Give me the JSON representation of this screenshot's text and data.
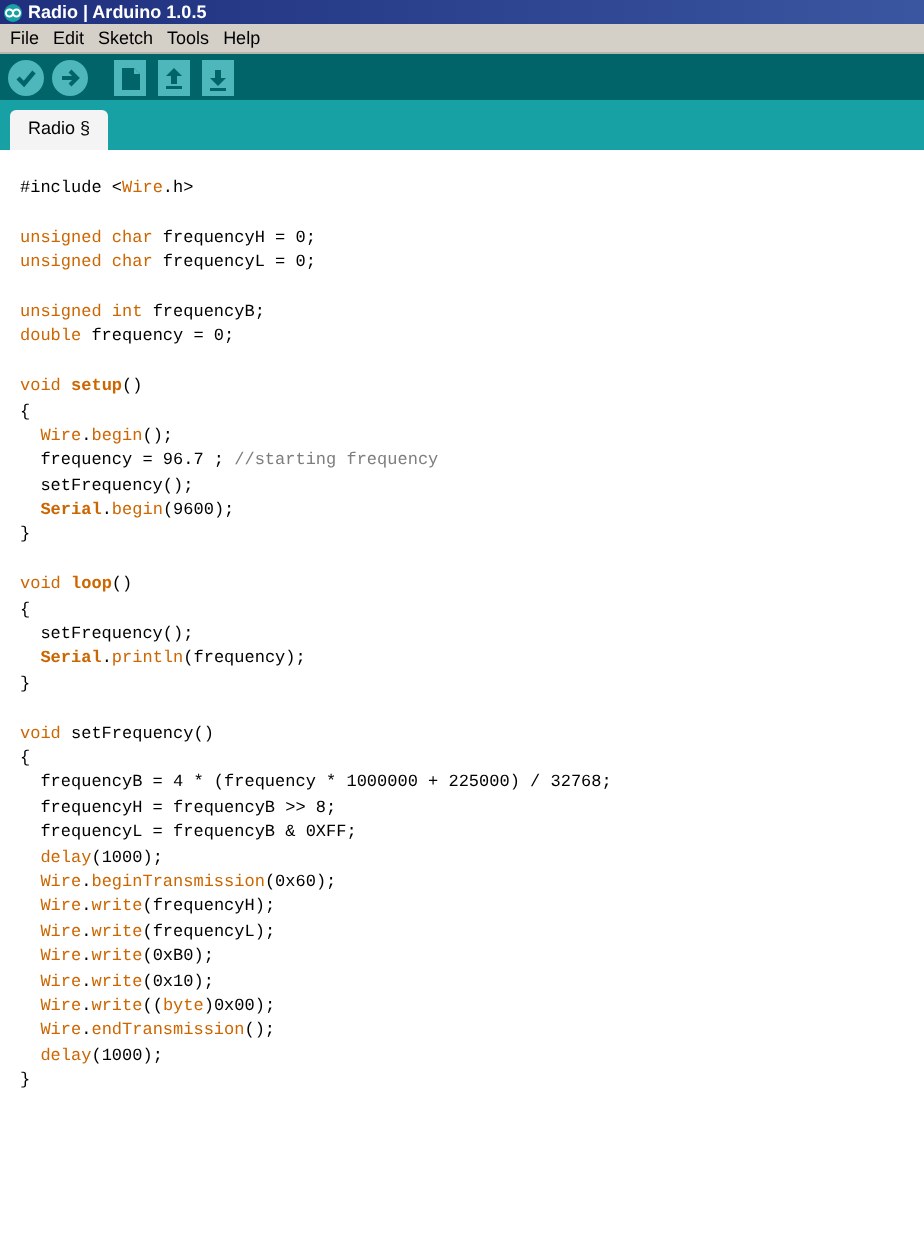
{
  "window": {
    "title": "Radio | Arduino 1.0.5"
  },
  "menu": [
    "File",
    "Edit",
    "Sketch",
    "Tools",
    "Help"
  ],
  "toolbar": [
    {
      "kind": "verify"
    },
    {
      "kind": "upload"
    },
    {
      "kind": "new"
    },
    {
      "kind": "open"
    },
    {
      "kind": "save"
    }
  ],
  "tabs": [
    {
      "label": "Radio §",
      "selected": true
    }
  ],
  "code": [
    {
      "kind": "code",
      "tokens": [
        {
          "text": "#include <",
          "kind": "plain"
        },
        {
          "text": "Wire",
          "kind": "name"
        },
        {
          "text": ".h>",
          "kind": "plain"
        }
      ]
    },
    {
      "kind": "blank"
    },
    {
      "kind": "code",
      "tokens": [
        {
          "text": "unsigned char",
          "kind": "keyword"
        },
        {
          "text": " frequencyH = 0;",
          "kind": "plain"
        }
      ]
    },
    {
      "kind": "code",
      "tokens": [
        {
          "text": "unsigned char",
          "kind": "keyword"
        },
        {
          "text": " frequencyL = 0;",
          "kind": "plain"
        }
      ]
    },
    {
      "kind": "blank"
    },
    {
      "kind": "code",
      "tokens": [
        {
          "text": "unsigned int",
          "kind": "keyword"
        },
        {
          "text": " frequencyB;",
          "kind": "plain"
        }
      ]
    },
    {
      "kind": "code",
      "tokens": [
        {
          "text": "double",
          "kind": "keyword"
        },
        {
          "text": " frequency = 0;",
          "kind": "plain"
        }
      ]
    },
    {
      "kind": "blank"
    },
    {
      "kind": "code",
      "tokens": [
        {
          "text": "void ",
          "kind": "keyword"
        },
        {
          "text": "setup",
          "kind": "bold"
        },
        {
          "text": "()",
          "kind": "plain"
        }
      ]
    },
    {
      "kind": "code",
      "tokens": [
        {
          "text": "{",
          "kind": "plain"
        }
      ]
    },
    {
      "kind": "code",
      "tokens": [
        {
          "text": "  Wire",
          "kind": "name"
        },
        {
          "text": ".",
          "kind": "plain"
        },
        {
          "text": "begin",
          "kind": "name"
        },
        {
          "text": "();",
          "kind": "plain"
        }
      ]
    },
    {
      "kind": "code",
      "tokens": [
        {
          "text": "  frequency = 96.7 ; ",
          "kind": "plain"
        },
        {
          "text": "//starting frequency",
          "kind": "comment"
        }
      ]
    },
    {
      "kind": "code",
      "tokens": [
        {
          "text": "  setFrequency();",
          "kind": "plain"
        }
      ]
    },
    {
      "kind": "code",
      "tokens": [
        {
          "text": "  Serial",
          "kind": "bold"
        },
        {
          "text": ".",
          "kind": "plain"
        },
        {
          "text": "begin",
          "kind": "name"
        },
        {
          "text": "(9600);",
          "kind": "plain"
        }
      ]
    },
    {
      "kind": "code",
      "tokens": [
        {
          "text": "}",
          "kind": "plain"
        }
      ]
    },
    {
      "kind": "blank"
    },
    {
      "kind": "code",
      "tokens": [
        {
          "text": "void ",
          "kind": "keyword"
        },
        {
          "text": "loop",
          "kind": "bold"
        },
        {
          "text": "()",
          "kind": "plain"
        }
      ]
    },
    {
      "kind": "code",
      "tokens": [
        {
          "text": "{",
          "kind": "plain"
        }
      ]
    },
    {
      "kind": "code",
      "tokens": [
        {
          "text": "  setFrequency();",
          "kind": "plain"
        }
      ]
    },
    {
      "kind": "code",
      "tokens": [
        {
          "text": "  Serial",
          "kind": "bold"
        },
        {
          "text": ".",
          "kind": "plain"
        },
        {
          "text": "println",
          "kind": "name"
        },
        {
          "text": "(frequency);",
          "kind": "plain"
        }
      ]
    },
    {
      "kind": "code",
      "tokens": [
        {
          "text": "}",
          "kind": "plain"
        }
      ]
    },
    {
      "kind": "blank"
    },
    {
      "kind": "code",
      "tokens": [
        {
          "text": "void",
          "kind": "keyword"
        },
        {
          "text": " setFrequency()",
          "kind": "plain"
        }
      ]
    },
    {
      "kind": "code",
      "tokens": [
        {
          "text": "{",
          "kind": "plain"
        }
      ]
    },
    {
      "kind": "code",
      "tokens": [
        {
          "text": "  frequencyB = 4 * (frequency * 1000000 + 225000) / 32768;",
          "kind": "plain"
        }
      ]
    },
    {
      "kind": "code",
      "tokens": [
        {
          "text": "  frequencyH = frequencyB >> 8;",
          "kind": "plain"
        }
      ]
    },
    {
      "kind": "code",
      "tokens": [
        {
          "text": "  frequencyL = frequencyB & 0XFF;",
          "kind": "plain"
        }
      ]
    },
    {
      "kind": "code",
      "tokens": [
        {
          "text": "  delay",
          "kind": "name"
        },
        {
          "text": "(1000);",
          "kind": "plain"
        }
      ]
    },
    {
      "kind": "code",
      "tokens": [
        {
          "text": "  Wire",
          "kind": "name"
        },
        {
          "text": ".",
          "kind": "plain"
        },
        {
          "text": "beginTransmission",
          "kind": "name"
        },
        {
          "text": "(0x60);",
          "kind": "plain"
        }
      ]
    },
    {
      "kind": "code",
      "tokens": [
        {
          "text": "  Wire",
          "kind": "name"
        },
        {
          "text": ".",
          "kind": "plain"
        },
        {
          "text": "write",
          "kind": "name"
        },
        {
          "text": "(frequencyH);",
          "kind": "plain"
        }
      ]
    },
    {
      "kind": "code",
      "tokens": [
        {
          "text": "  Wire",
          "kind": "name"
        },
        {
          "text": ".",
          "kind": "plain"
        },
        {
          "text": "write",
          "kind": "name"
        },
        {
          "text": "(frequencyL);",
          "kind": "plain"
        }
      ]
    },
    {
      "kind": "code",
      "tokens": [
        {
          "text": "  Wire",
          "kind": "name"
        },
        {
          "text": ".",
          "kind": "plain"
        },
        {
          "text": "write",
          "kind": "name"
        },
        {
          "text": "(0xB0);",
          "kind": "plain"
        }
      ]
    },
    {
      "kind": "code",
      "tokens": [
        {
          "text": "  Wire",
          "kind": "name"
        },
        {
          "text": ".",
          "kind": "plain"
        },
        {
          "text": "write",
          "kind": "name"
        },
        {
          "text": "(0x10);",
          "kind": "plain"
        }
      ]
    },
    {
      "kind": "code",
      "tokens": [
        {
          "text": "  Wire",
          "kind": "name"
        },
        {
          "text": ".",
          "kind": "plain"
        },
        {
          "text": "write",
          "kind": "name"
        },
        {
          "text": "((",
          "kind": "plain"
        },
        {
          "text": "byte",
          "kind": "keyword"
        },
        {
          "text": ")0x00);",
          "kind": "plain"
        }
      ]
    },
    {
      "kind": "code",
      "tokens": [
        {
          "text": "  Wire",
          "kind": "name"
        },
        {
          "text": ".",
          "kind": "plain"
        },
        {
          "text": "endTransmission",
          "kind": "name"
        },
        {
          "text": "();",
          "kind": "plain"
        }
      ]
    },
    {
      "kind": "code",
      "tokens": [
        {
          "text": "  delay",
          "kind": "name"
        },
        {
          "text": "(1000);",
          "kind": "plain"
        }
      ]
    },
    {
      "kind": "code",
      "tokens": [
        {
          "text": "}",
          "kind": "plain"
        }
      ]
    }
  ]
}
